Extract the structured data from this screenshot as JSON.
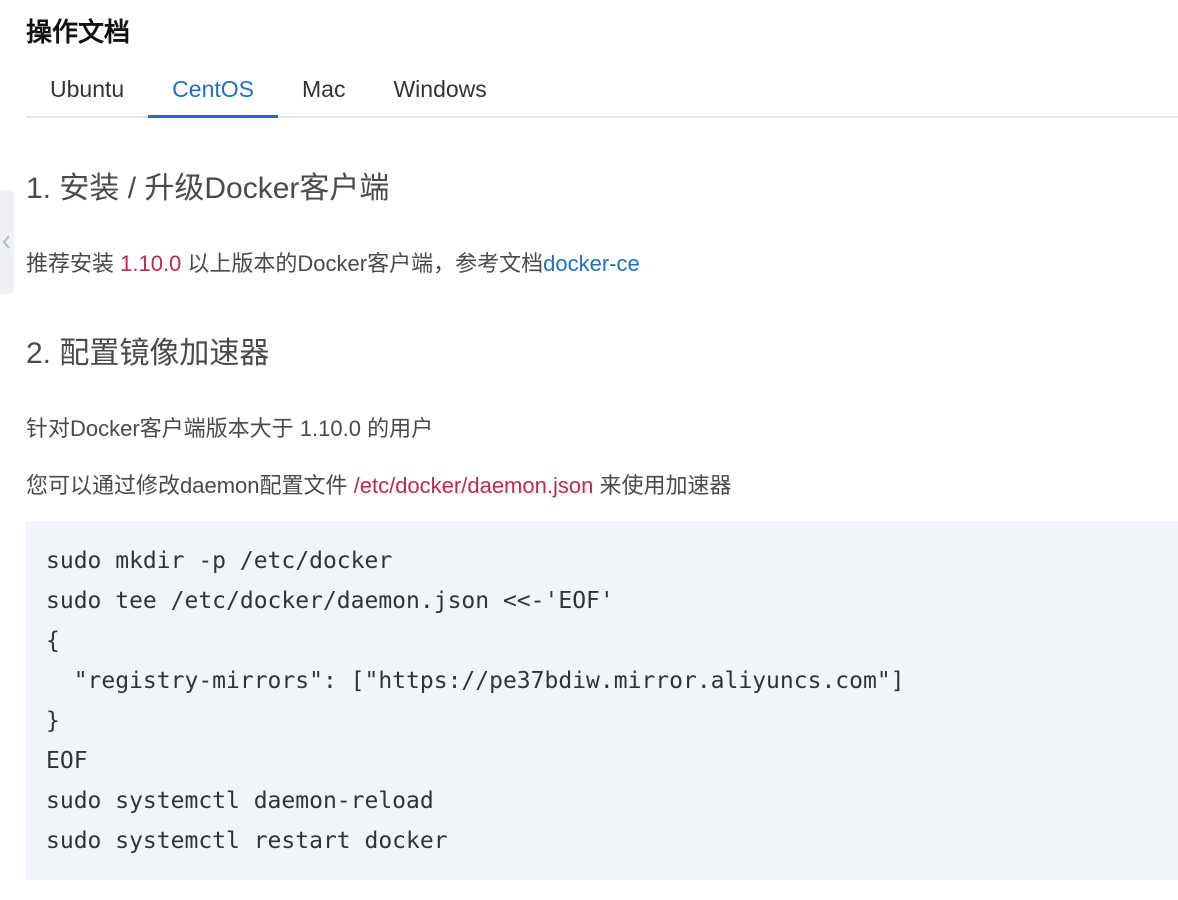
{
  "page": {
    "title": "操作文档"
  },
  "tabs": [
    {
      "label": "Ubuntu",
      "active": false
    },
    {
      "label": "CentOS",
      "active": true
    },
    {
      "label": "Mac",
      "active": false
    },
    {
      "label": "Windows",
      "active": false
    }
  ],
  "section1": {
    "heading": "1. 安装 / 升级Docker客户端",
    "text_before": "推荐安装 ",
    "version": "1.10.0",
    "text_middle": " 以上版本的Docker客户端，参考文档",
    "link_text": "docker-ce"
  },
  "section2": {
    "heading": "2. 配置镜像加速器",
    "line1": "针对Docker客户端版本大于 1.10.0 的用户",
    "line2_before": "您可以通过修改daemon配置文件 ",
    "config_path": "/etc/docker/daemon.json",
    "line2_after": " 来使用加速器",
    "code_lines": [
      "sudo mkdir -p /etc/docker",
      "sudo tee /etc/docker/daemon.json <<-'EOF'",
      "{",
      "  \"registry-mirrors\": [\"https://pe37bdiw.mirror.aliyuncs.com\"]",
      "}",
      "EOF",
      "sudo systemctl daemon-reload",
      "sudo systemctl restart docker"
    ]
  },
  "colors": {
    "accent": "#c0294f",
    "link": "#1f6fc5",
    "code_background": "#f1f5fa"
  },
  "icons": {
    "side_handle": "chevron-left-icon"
  }
}
